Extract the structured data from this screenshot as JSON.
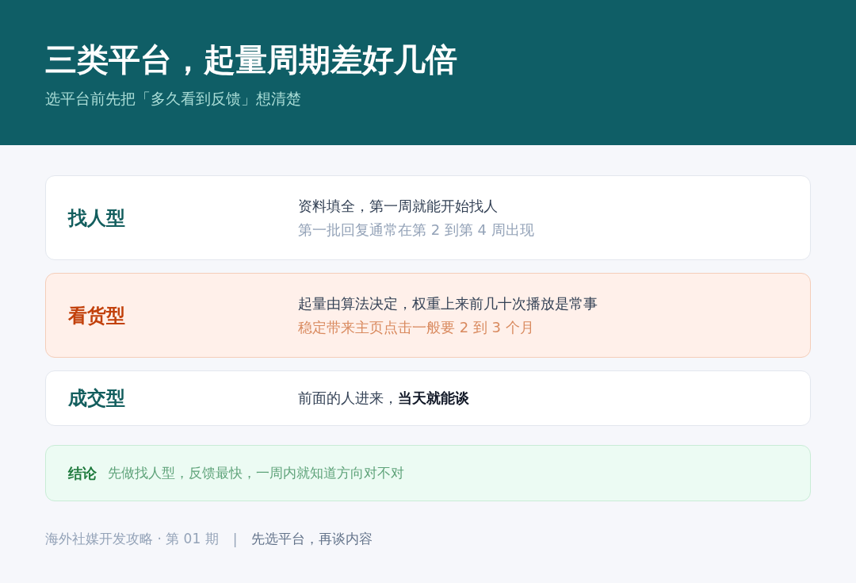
{
  "header": {
    "title": "三类平台，起量周期差好几倍",
    "subtitle": "选平台前先把「多久看到反馈」想清楚"
  },
  "cards": [
    {
      "kind": "normal",
      "label": "找人型",
      "lines": [
        "资料填全，第一周就能开始找人",
        "第一批回复通常在第 2 到第 4 周出现"
      ]
    },
    {
      "kind": "highlight",
      "label": "看货型",
      "lines": [
        "起量由算法决定，权重上来前几十次播放是常事",
        "稳定带来主页点击一般要 2 到 3 个月"
      ]
    },
    {
      "kind": "normal",
      "label": "成交型",
      "lines": [
        "前面的人进来，**当天就能谈**"
      ]
    }
  ],
  "conclusion": {
    "label": "结论",
    "text": "先做找人型，反馈最快，一周内就知道方向对不对"
  },
  "footer": {
    "series": "海外社媒开发攻略 · 第 01 期",
    "separator": "|",
    "tagline": "先选平台，再谈内容"
  }
}
